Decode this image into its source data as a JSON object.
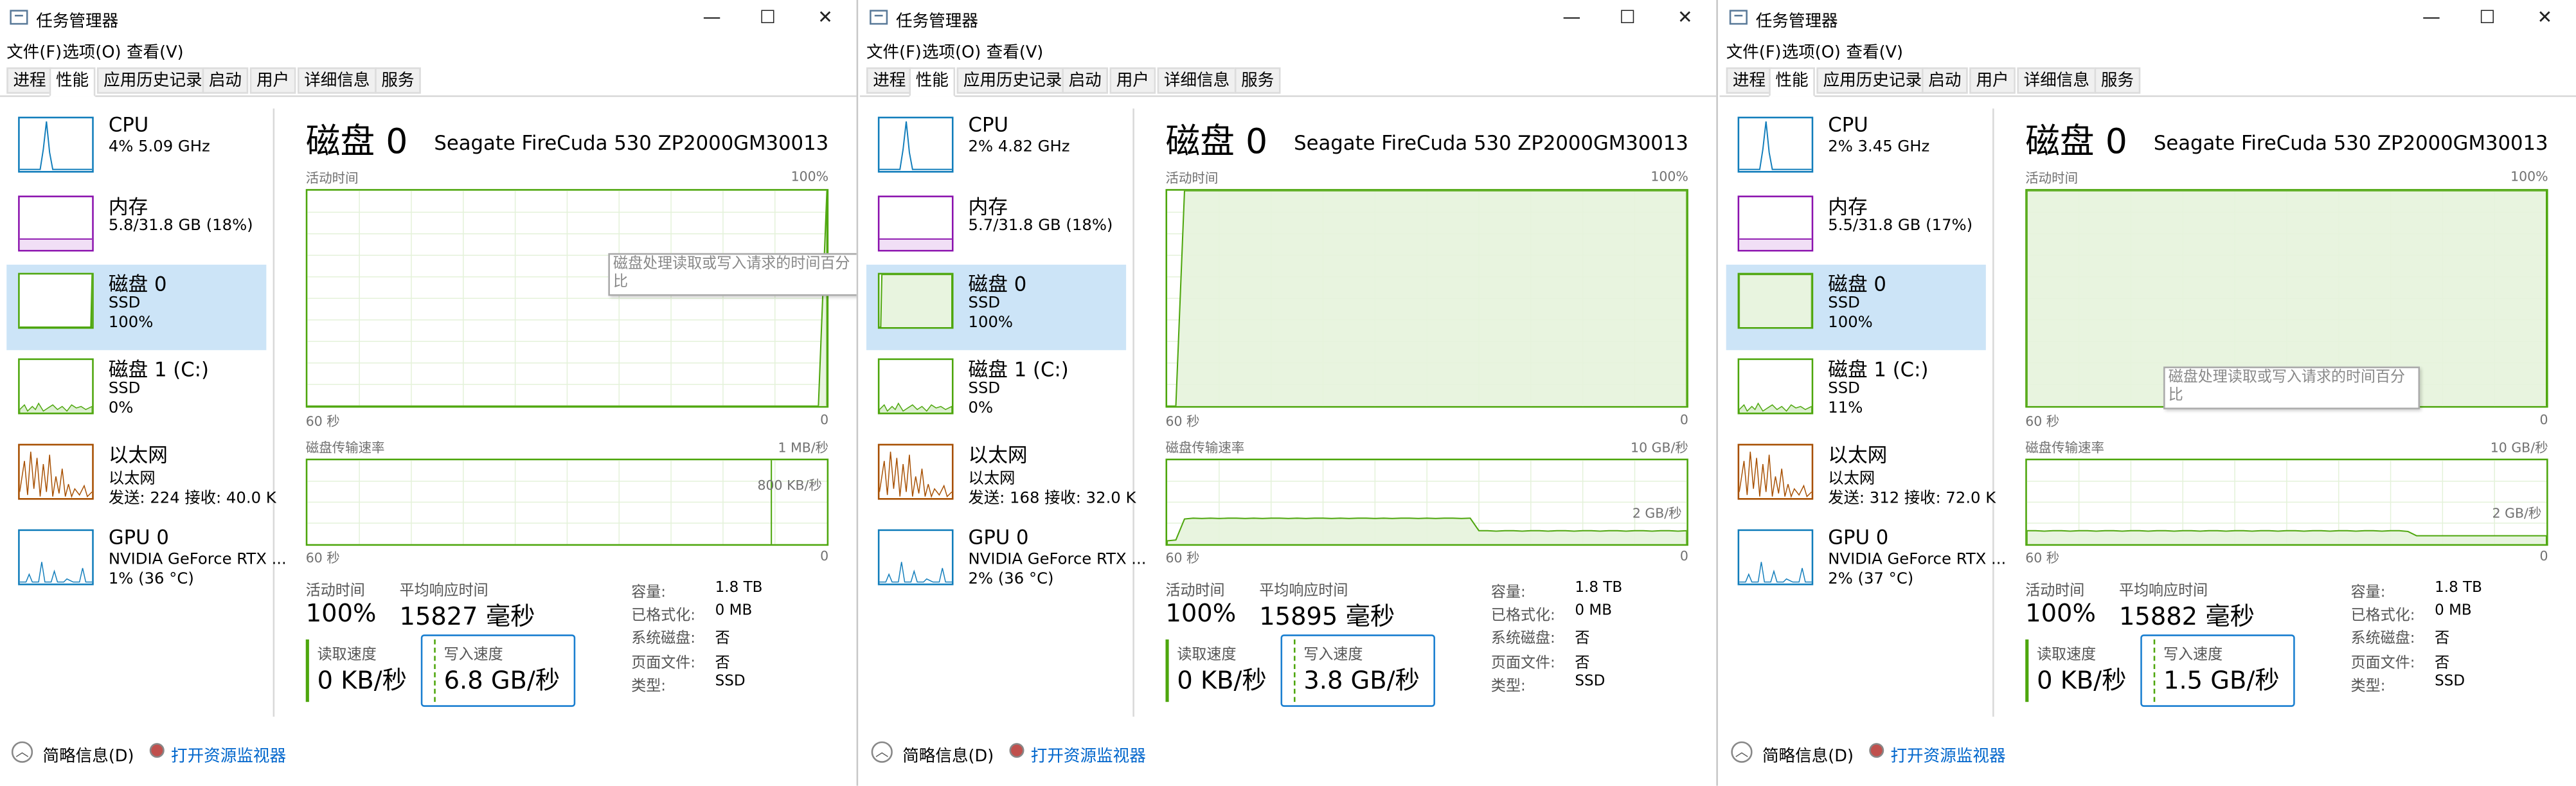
{
  "colors": {
    "disk": "#4da60c",
    "cpu": "#117dbb",
    "mem": "#8b12ae",
    "net": "#a74f01",
    "gpu": "#117dbb",
    "select": "#cce4f7",
    "link": "#0066cc"
  },
  "window": {
    "title": "任务管理器",
    "minimize_icon": "minimize-icon",
    "maximize_icon": "maximize-icon",
    "close_icon": "close-icon",
    "menu": [
      "文件(F)",
      "选项(O)",
      "查看(V)"
    ],
    "tabs": [
      "进程",
      "性能",
      "应用历史记录",
      "启动",
      "用户",
      "详细信息",
      "服务"
    ],
    "active_tab": "性能",
    "sidebar_labels": {
      "cpu": "CPU",
      "mem": "内存",
      "disk0": "磁盘 0",
      "disk1": "磁盘 1 (C:)",
      "eth": "以太网",
      "gpu": "GPU 0",
      "ssd": "SSD",
      "eth_sub": "以太网",
      "gpu_sub": "NVIDIA GeForce RTX ..."
    },
    "detail_title": "磁盘 0",
    "disk_model": "Seagate FireCuda 530 ZP2000GM30013",
    "graph1_label": "活动时间",
    "graph1_max": "100%",
    "axis_left": "60 秒",
    "axis_right": "0",
    "graph2_label": "磁盘传输速率",
    "stats": {
      "active_label": "活动时间",
      "resp_label": "平均响应时间",
      "read_label": "读取速度",
      "write_label": "写入速度"
    },
    "props": {
      "cap_label": "容量:",
      "cap": "1.8 TB",
      "fmt_label": "已格式化:",
      "fmt": "0 MB",
      "sys_label": "系统磁盘:",
      "sys": "否",
      "page_label": "页面文件:",
      "page": "否",
      "type_label": "类型:",
      "type": "SSD"
    },
    "footer": {
      "brief": "简略信息(D)",
      "monitor": "打开资源监视器"
    }
  },
  "panels": [
    {
      "cpu": "4%  5.09 GHz",
      "mem": "5.8/31.8 GB (18%)",
      "disk0_pct": "100%",
      "disk1_pct": "0%",
      "eth": "发送: 224  接收: 40.0 K",
      "gpu": "1% (36 °C)",
      "active": "100%",
      "resp": "15827 毫秒",
      "read": "0 KB/秒",
      "write": "6.8 GB/秒",
      "rate_max": "1 MB/秒",
      "rate_mid": "800 KB/秒",
      "tooltip": "磁盘处理读取或写入请求的时间百分比",
      "activity_curve": [
        0,
        0,
        0,
        0,
        0,
        0,
        0,
        0,
        0,
        0,
        0,
        0,
        0,
        0,
        0,
        0,
        0,
        0,
        0,
        0,
        0,
        0,
        0,
        0,
        0,
        0,
        0,
        0,
        0,
        0,
        0,
        0,
        0,
        0,
        0,
        0,
        0,
        0,
        0,
        0,
        0,
        0,
        0,
        0,
        0,
        0,
        0,
        0,
        0,
        0,
        0,
        0,
        0,
        0,
        0,
        0,
        0,
        0,
        0,
        0,
        0,
        100
      ],
      "rate_curve": []
    },
    {
      "cpu": "2%  4.82 GHz",
      "mem": "5.7/31.8 GB (18%)",
      "disk0_pct": "100%",
      "disk1_pct": "0%",
      "eth": "发送: 168  接收: 32.0 K",
      "gpu": "2% (36 °C)",
      "active": "100%",
      "resp": "15895 毫秒",
      "read": "0 KB/秒",
      "write": "3.8 GB/秒",
      "rate_max": "10 GB/秒",
      "rate_mid": "2 GB/秒",
      "tooltip": "",
      "activity_curve": [
        0,
        0,
        100,
        100,
        100,
        100,
        100,
        100,
        100,
        100,
        100,
        100,
        100,
        100,
        100,
        100,
        100,
        100,
        100,
        100,
        100,
        100,
        100,
        100,
        100,
        100,
        100,
        100,
        100,
        100,
        100,
        100,
        100,
        100,
        100,
        100,
        100,
        100,
        100,
        100,
        100,
        100,
        100,
        100,
        100,
        100,
        100,
        100,
        100,
        100,
        100,
        100,
        100,
        100,
        100,
        100,
        100,
        100,
        100,
        100,
        100
      ],
      "rate_curve": [
        0.4,
        0.5,
        3.0,
        3.1,
        3.05,
        3.1,
        3.05,
        3.1,
        3.1,
        3.05,
        3.1,
        3.05,
        3.1,
        3.1,
        3.05,
        3.1,
        3.05,
        3.1,
        3.1,
        3.05,
        3.1,
        3.05,
        3.1,
        3.1,
        3.05,
        3.1,
        3.05,
        3.1,
        3.1,
        3.05,
        3.1,
        3.05,
        3.1,
        3.1,
        3.05,
        3.1,
        1.6,
        1.6,
        1.55,
        1.6,
        1.6,
        1.55,
        1.6,
        1.6,
        1.55,
        1.6,
        1.6,
        1.55,
        1.6,
        1.6,
        1.55,
        1.6,
        1.6,
        1.55,
        1.6,
        1.6,
        1.55,
        1.6,
        1.6,
        1.55,
        1.6
      ]
    },
    {
      "cpu": "2%  3.45 GHz",
      "mem": "5.5/31.8 GB (17%)",
      "disk0_pct": "100%",
      "disk1_pct": "11%",
      "eth": "发送: 312  接收: 72.0 K",
      "gpu": "2% (37 °C)",
      "active": "100%",
      "resp": "15882 毫秒",
      "read": "0 KB/秒",
      "write": "1.5 GB/秒",
      "rate_max": "10 GB/秒",
      "rate_mid": "2 GB/秒",
      "tooltip": "磁盘处理读取或写入请求的时间百分比",
      "activity_curve": [
        100,
        100,
        100,
        100,
        100,
        100,
        100,
        100,
        100,
        100,
        100,
        100,
        100,
        100,
        100,
        100,
        100,
        100,
        100,
        100,
        100,
        100,
        100,
        100,
        100,
        100,
        100,
        100,
        100,
        100,
        100,
        100,
        100,
        100,
        100,
        100,
        100,
        100,
        100,
        100,
        100,
        100,
        100,
        100,
        100,
        100,
        100,
        100,
        100,
        100,
        100,
        100,
        100,
        100,
        100,
        100,
        100,
        100,
        100,
        100,
        100
      ],
      "rate_curve": [
        1.6,
        1.6,
        1.55,
        1.6,
        1.6,
        1.55,
        1.6,
        1.6,
        1.55,
        1.6,
        1.6,
        1.55,
        1.6,
        1.6,
        1.55,
        1.6,
        1.6,
        1.55,
        1.6,
        1.6,
        1.55,
        1.6,
        1.6,
        1.55,
        1.6,
        1.6,
        1.55,
        1.6,
        1.6,
        1.55,
        1.6,
        1.6,
        1.55,
        1.6,
        1.6,
        1.55,
        1.6,
        1.6,
        1.55,
        1.6,
        1.6,
        1.55,
        1.6,
        1.6,
        1.5,
        1.0,
        1.0,
        1.0,
        1.0,
        1.0,
        1.0,
        1.0,
        1.0,
        1.0,
        1.0,
        1.0,
        1.0,
        1.0,
        1.0,
        1.0,
        1.0
      ]
    }
  ]
}
